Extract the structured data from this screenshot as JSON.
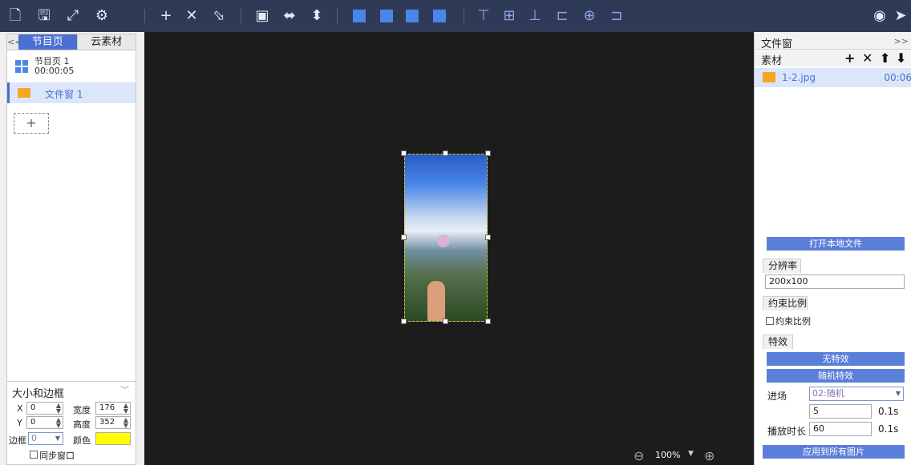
{
  "toolbar": {
    "icons": [
      "new-file-icon",
      "save-icon",
      "resize-icon",
      "settings-icon",
      "add-icon",
      "delete-icon",
      "select-icon",
      "fit-icon",
      "stretch-horizontal-icon",
      "stretch-vertical-icon",
      "layer-bring-front-icon",
      "layer-bring-forward-icon",
      "layer-send-backward-icon",
      "layer-send-back-icon",
      "align-top-icon",
      "align-middle-icon",
      "align-bottom-icon",
      "align-left-icon",
      "align-center-icon",
      "align-right-icon",
      "preview-icon",
      "send-icon"
    ],
    "accent": "#4a86e8",
    "bg": "#2f3a57"
  },
  "left": {
    "collapse": "<<",
    "tabs": [
      "节目页",
      "云素材"
    ],
    "program": {
      "name": "节目页 1",
      "duration": "00:00:05"
    },
    "file_window": "文件窗 1",
    "add_symbol": "+"
  },
  "size_panel": {
    "title": "大小和边框",
    "x_label": "X",
    "x_value": "0",
    "y_label": "Y",
    "y_value": "0",
    "width_label": "宽度",
    "width_value": "176",
    "height_label": "高度",
    "height_value": "352",
    "border_label": "边框",
    "border_value": "0",
    "color_label": "颜色",
    "color_value": "#ffff00",
    "sync_label": "同步窗口"
  },
  "canvas": {
    "zoom": "100%"
  },
  "right": {
    "title": "文件窗",
    "expand": ">>",
    "material_title": "素材",
    "actions": [
      "+",
      "✕",
      "⬆",
      "⬇"
    ],
    "file": {
      "name": "1-2.jpg",
      "duration": "00:06"
    },
    "open_local": "打开本地文件",
    "resolution_tab": "分辨率",
    "resolution_value": "200x100",
    "ratio_tab": "约束比例",
    "ratio_checkbox": "约束比例",
    "effects_tab": "特效",
    "no_effect": "无特效",
    "random_effect": "随机特效",
    "entry_label": "进场",
    "entry_value": "02:随机",
    "entry_speed": "5",
    "entry_unit": "0.1s",
    "play_label": "播放时长",
    "play_value": "60",
    "play_unit": "0.1s",
    "apply_all": "应用到所有图片"
  }
}
